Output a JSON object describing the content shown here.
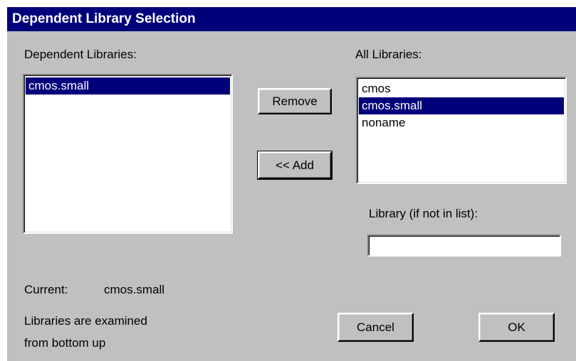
{
  "dialog": {
    "title": "Dependent Library Selection"
  },
  "dependent": {
    "label": "Dependent Libraries:",
    "items": [
      "cmos.small"
    ],
    "selected_index": 0
  },
  "all": {
    "label": "All Libraries:",
    "items": [
      "cmos",
      "cmos.small",
      "noname"
    ],
    "selected_index": 1
  },
  "buttons": {
    "remove": "Remove",
    "add": "<< Add",
    "cancel": "Cancel",
    "ok": "OK"
  },
  "library_input": {
    "label": "Library (if not in list):",
    "value": ""
  },
  "current": {
    "label": "Current:",
    "value": "cmos.small"
  },
  "note": {
    "line1": "Libraries are examined",
    "line2": "from bottom up"
  },
  "colors": {
    "title_bar": "#00007b",
    "dialog_bg": "#c0c0c0",
    "selection": "#00007b"
  }
}
